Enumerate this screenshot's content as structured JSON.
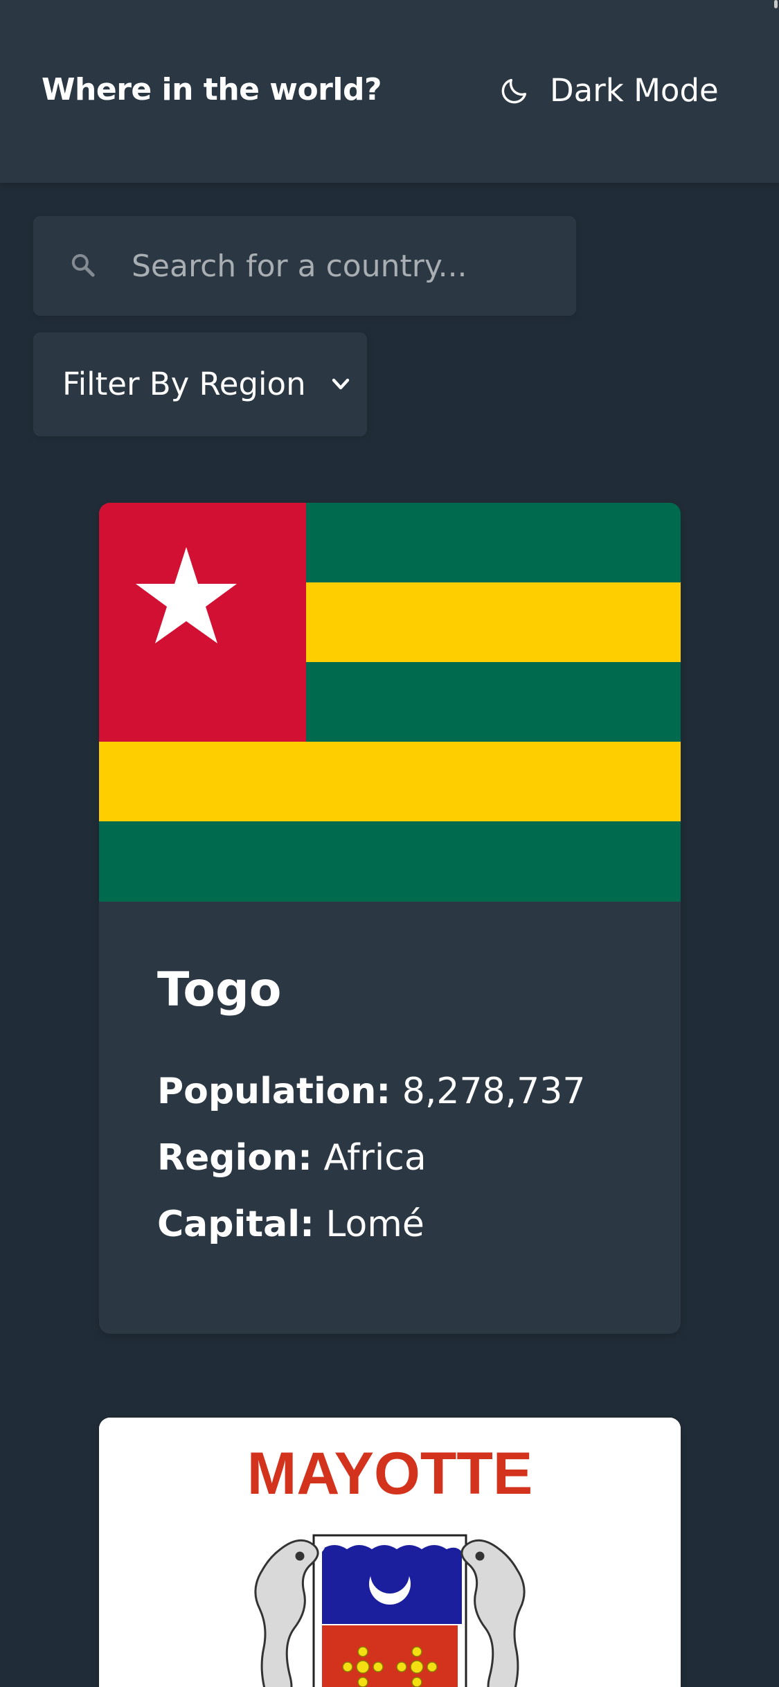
{
  "header": {
    "title": "Where in the world?",
    "theme_toggle_label": "Dark Mode",
    "theme_icon": "moon-icon"
  },
  "search": {
    "placeholder": "Search for a country...",
    "value": "",
    "icon": "search-icon"
  },
  "filter": {
    "label": "Filter By Region",
    "icon": "chevron-down-icon"
  },
  "countries": [
    {
      "name": "Togo",
      "population_label": "Population:",
      "population": "8,278,737",
      "region_label": "Region:",
      "region": "Africa",
      "capital_label": "Capital:",
      "capital": "Lomé",
      "flag_colors": {
        "red": "#d21034",
        "green": "#006a4e",
        "yellow": "#ffce00",
        "star": "#ffffff"
      }
    },
    {
      "flag_text": "MAYOTTE",
      "flag_colors": {
        "background": "#ffffff",
        "text": "#d3321c",
        "shield_blue": "#1b1f9e",
        "shield_red": "#d3321c",
        "flower": "#f4e012",
        "seahorse": "#d9d9d9"
      }
    }
  ],
  "theme_colors": {
    "background": "#202c37",
    "element": "#2b3844",
    "text": "#ffffff",
    "placeholder": "#a9aeb3"
  }
}
